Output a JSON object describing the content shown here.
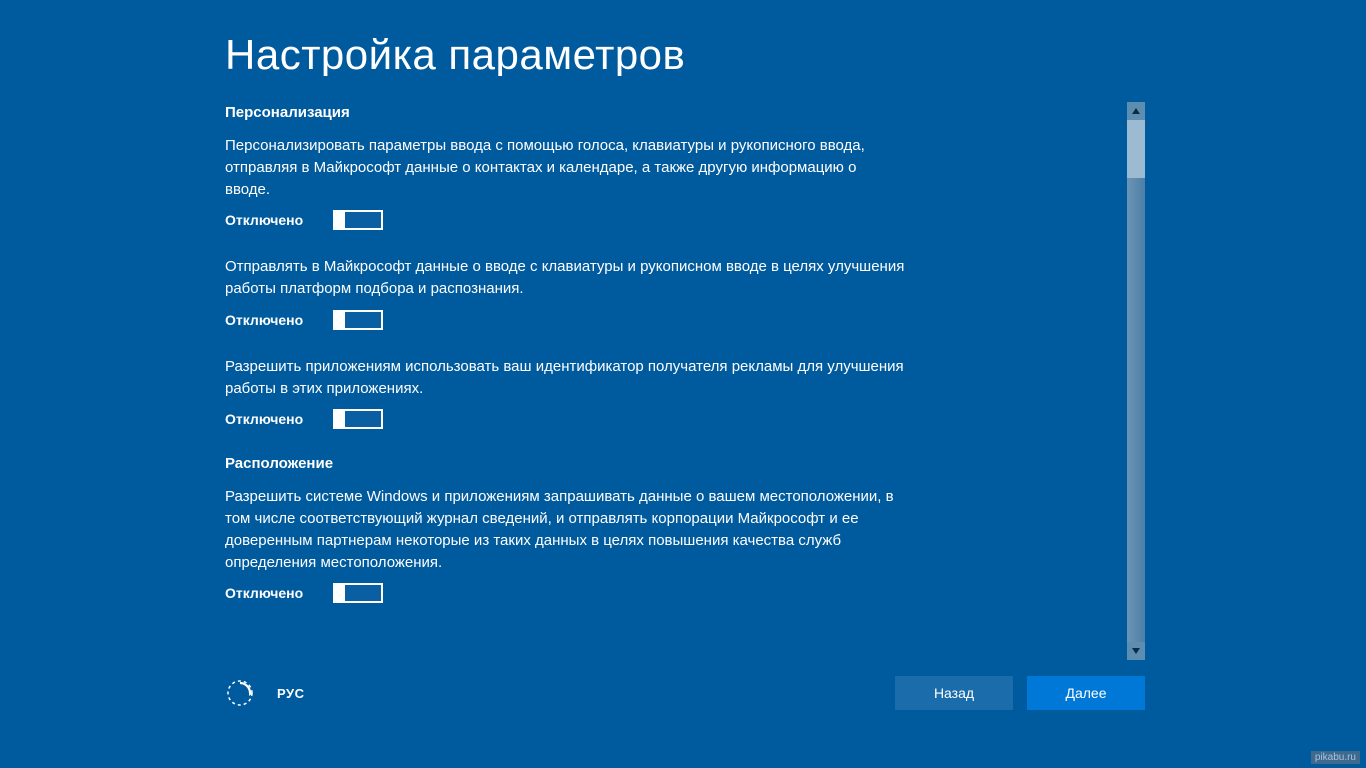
{
  "page_title": "Настройка параметров",
  "sections": [
    {
      "heading": "Персонализация",
      "items": [
        {
          "desc": "Персонализировать параметры ввода с помощью голоса, клавиатуры и рукописного ввода, отправляя в Майкрософт данные о контактах и календаре, а также другую информацию о вводе.",
          "state_label": "Отключено",
          "on": false
        },
        {
          "desc": "Отправлять в Майкрософт данные о вводе с клавиатуры и рукописном вводе в целях улучшения работы платформ подбора и распознания.",
          "state_label": "Отключено",
          "on": false
        },
        {
          "desc": "Разрешить приложениям использовать ваш идентификатор получателя рекламы для улучшения работы в этих приложениях.",
          "state_label": "Отключено",
          "on": false
        }
      ]
    },
    {
      "heading": "Расположение",
      "items": [
        {
          "desc": "Разрешить системе Windows и приложениям запрашивать данные о вашем местоположении, в том числе соответствующий журнал сведений, и отправлять корпорации Майкрософт и ее доверенным партнерам некоторые из таких данных в целях повышения качества служб определения местоположения.",
          "state_label": "Отключено",
          "on": false
        }
      ]
    }
  ],
  "footer": {
    "language": "РУС",
    "back": "Назад",
    "next": "Далее"
  },
  "watermark": "pikabu.ru"
}
